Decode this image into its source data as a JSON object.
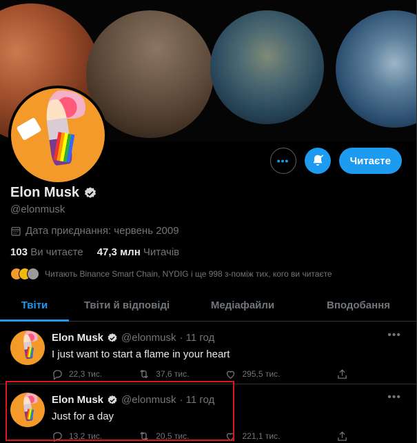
{
  "profile": {
    "name": "Elon Musk",
    "handle": "@elonmusk",
    "joined": "Дата приєднання: червень 2009",
    "following_count": "103",
    "following_label": "Ви читаєте",
    "followers_count": "47,3 млн",
    "followers_label": "Читачів",
    "followed_by_text": "Читають Binance Smart Chain, NYDIG і ще 998 з-поміж тих, кого ви читаєте"
  },
  "actions": {
    "more_icon": "more-icon",
    "bell_icon": "bell-icon",
    "follow_label": "Читаєте"
  },
  "tabs": [
    {
      "label": "Твіти",
      "active": true
    },
    {
      "label": "Твіти й відповіді",
      "active": false
    },
    {
      "label": "Медіафайли",
      "active": false
    },
    {
      "label": "Вподобання",
      "active": false
    }
  ],
  "tweets": [
    {
      "name": "Elon Musk",
      "handle": "@elonmusk",
      "time": "· 11 год",
      "text": "I just want to start a flame in your heart",
      "replies": "22,3 тис.",
      "retweets": "37,6 тис.",
      "likes": "295,5 тис."
    },
    {
      "name": "Elon Musk",
      "handle": "@elonmusk",
      "time": "· 11 год",
      "text": "Just for a day",
      "replies": "13,2 тис.",
      "retweets": "20,5 тис.",
      "likes": "221,1 тис."
    }
  ],
  "colors": {
    "accent": "#1d9bf0",
    "highlight": "#e0161e",
    "background": "#000000"
  }
}
